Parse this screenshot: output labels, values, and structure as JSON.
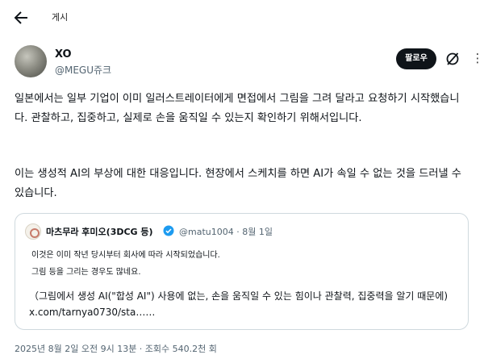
{
  "header": {
    "title": "게시"
  },
  "author": {
    "name": "XO",
    "handle": "@MEGU쥬크",
    "follow_label": "팔로우"
  },
  "post": {
    "paragraph1": "일본에서는 일부 기업이 이미 일러스트레이터에게 면접에서 그림을 그려 달라고 요청하기 시작했습니다. 관찰하고, 집중하고, 실제로 손을 움직일 수 있는지 확인하기 위해서입니다.",
    "paragraph2": "이는 생성적 AI의 부상에 대한 대응입니다. 현장에서 스케치를 하면 AI가 속일 수 없는 것을 드러낼 수 있습니다."
  },
  "quote": {
    "name": "마츠무라 후미오(3DCG 등)",
    "meta": "@matu1004 · 8월 1일",
    "line1": "이것은 이미 작년 당시부터 회사에 따라 시작되었습니다.",
    "line2": "그림 등을 그리는 경우도 많네요.",
    "line3": "（그림에서 생성 AI(\"합성 AI\") 사용에 없는, 손을 움직일 수 있는 힘이나 관찰력, 집중력을 알기 때문에) x.com/tarnya0730/sta……"
  },
  "footer": {
    "timestamp": "2025년 8월 2일 오전 9시 13분 · 조회수 540.2천 회"
  },
  "colors": {
    "text": "#0f1419",
    "secondary": "#536471",
    "verified": "#1d9bf0",
    "border": "#cfd9de"
  },
  "icons": [
    "back-arrow-icon",
    "grok-icon",
    "more-icon",
    "verified-badge-icon"
  ]
}
